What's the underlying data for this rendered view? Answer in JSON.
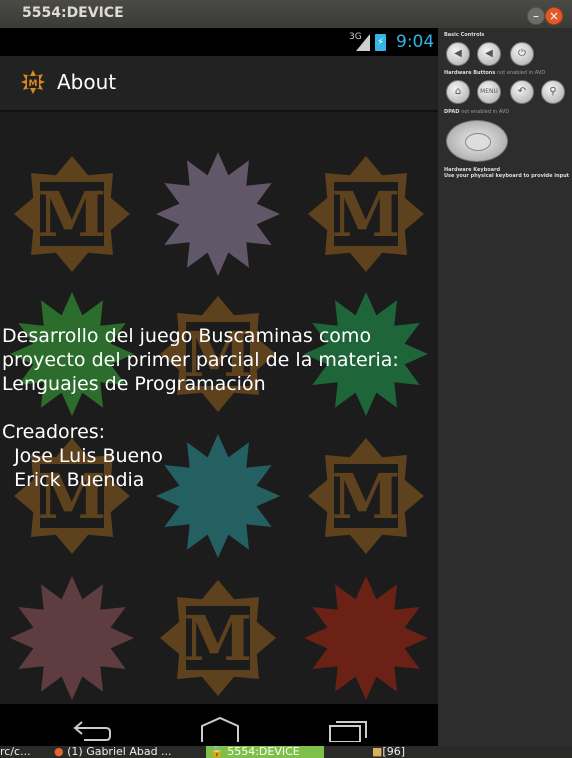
{
  "window": {
    "title": "5554:DEVICE"
  },
  "status_bar": {
    "network": "3G",
    "time": "9:04"
  },
  "action_bar": {
    "title": "About"
  },
  "about": {
    "line1": "Desarrollo del juego Buscaminas como",
    "line2": "proyecto del primer parcial de la materia:",
    "line3": "Lenguajes de Programación",
    "creators_label": "Creadores:",
    "creator1": "  Jose Luis Bueno",
    "creator2": "  Erick Buendia"
  },
  "side_panel": {
    "basic_controls": "Basic Controls",
    "hardware_buttons": "Hardware Buttons",
    "hardware_buttons_note": "not enabled in AVD",
    "menu_label": "MENU",
    "dpad": "DPAD",
    "dpad_note": "not enabled in AVD",
    "keyboard": "Hardware Keyboard",
    "keyboard_note": "Use your physical keyboard to provide input"
  },
  "taskbar": {
    "item1": "rc/c...",
    "item2": "(1) Gabriel Abad ...",
    "item3": "5554:DEVICE",
    "item4": "[96]"
  },
  "colors": {
    "accent": "#33b5e5",
    "tile_brown": "#8b5a1e",
    "tile_purple": "#6f6275",
    "tile_green": "#2f7a2f",
    "tile_green2": "#1f7340",
    "tile_teal": "#266b6e",
    "tile_rose": "#6a4245",
    "tile_red": "#7a2216"
  },
  "background_tiles": [
    {
      "row": 0,
      "col": 0,
      "kind": "logo",
      "color": "#8b5a1e"
    },
    {
      "row": 0,
      "col": 1,
      "kind": "mine",
      "color": "#6f6275"
    },
    {
      "row": 0,
      "col": 2,
      "kind": "logo",
      "color": "#8b5a1e"
    },
    {
      "row": 1,
      "col": 0,
      "kind": "mine",
      "color": "#2f7a2f"
    },
    {
      "row": 1,
      "col": 1,
      "kind": "logo",
      "color": "#8b5a1e"
    },
    {
      "row": 1,
      "col": 2,
      "kind": "mine",
      "color": "#1f7340"
    },
    {
      "row": 2,
      "col": 0,
      "kind": "logo",
      "color": "#8b5a1e"
    },
    {
      "row": 2,
      "col": 1,
      "kind": "mine",
      "color": "#266b6e"
    },
    {
      "row": 2,
      "col": 2,
      "kind": "logo",
      "color": "#8b5a1e"
    },
    {
      "row": 3,
      "col": 0,
      "kind": "mine",
      "color": "#6a4245"
    },
    {
      "row": 3,
      "col": 1,
      "kind": "logo",
      "color": "#8b5a1e"
    },
    {
      "row": 3,
      "col": 2,
      "kind": "mine",
      "color": "#7a2216"
    }
  ]
}
